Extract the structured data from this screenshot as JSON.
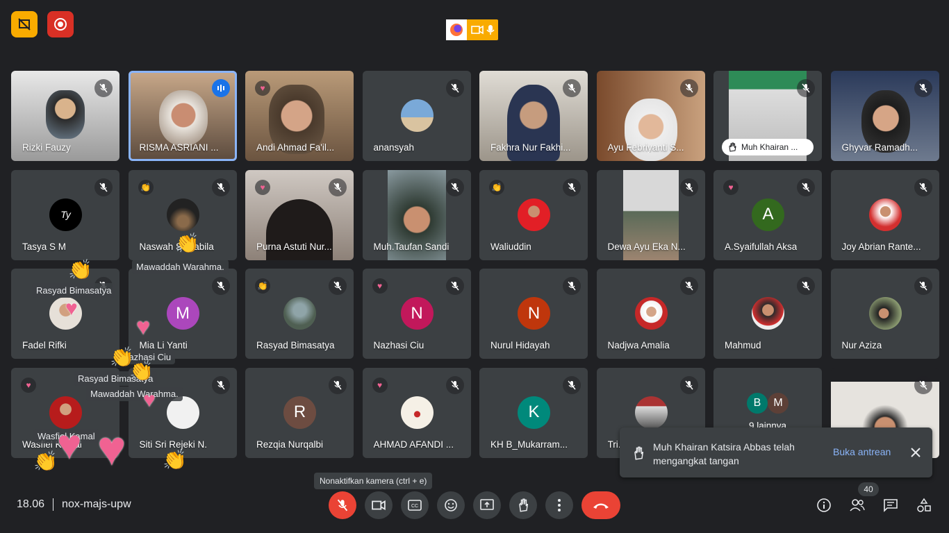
{
  "meeting": {
    "time": "18.06",
    "code": "nox-majs-upw",
    "participant_count": "40",
    "tooltip": "Nonaktifkan kamera (ctrl + e)"
  },
  "participants": [
    {
      "name": "Rizki Fauzy"
    },
    {
      "name": "RISMA ASRIANI ..."
    },
    {
      "name": "Andi Ahmad Fa'il..."
    },
    {
      "name": "anansyah"
    },
    {
      "name": "Fakhra Nur Fakhi..."
    },
    {
      "name": "Ayu Febriyanti S..."
    },
    {
      "name": "Muh Khairan ..."
    },
    {
      "name": "Ghyvar Ramadh..."
    },
    {
      "name": "Tasya S M"
    },
    {
      "name": "Naswah Salzabila"
    },
    {
      "name": "Purna Astuti Nur..."
    },
    {
      "name": "Muh.Taufan Sandi"
    },
    {
      "name": "Waliuddin"
    },
    {
      "name": "Dewa Ayu Eka N..."
    },
    {
      "name": "A.Syaifullah Aksa",
      "initial": "A"
    },
    {
      "name": "Joy Abrian Rante..."
    },
    {
      "name": "Fadel Rifki"
    },
    {
      "name": "Mia Li Yanti",
      "initial": "M"
    },
    {
      "name": "Rasyad Bimasatya"
    },
    {
      "name": "Nazhasi Ciu",
      "initial": "N"
    },
    {
      "name": "Nurul Hidayah",
      "initial": "N"
    },
    {
      "name": "Nadjwa Amalia"
    },
    {
      "name": "Mahmud"
    },
    {
      "name": "Nur Aziza"
    },
    {
      "name": "Wasfiel Kamal"
    },
    {
      "name": "Siti Sri Rejeki N."
    },
    {
      "name": "Rezqia Nurqalbi",
      "initial": "R"
    },
    {
      "name": "AHMAD AFANDI ..."
    },
    {
      "name": "KH B_Mukarram...",
      "initial": "K"
    },
    {
      "name": "Tri..."
    },
    {
      "name": "9 lainnya",
      "initials": [
        "B",
        "M"
      ]
    },
    {
      "name": ""
    }
  ],
  "reaction_labels": [
    "Rasyad Bimasatya",
    "Mawaddah Warahma.",
    "Nazhasi Ciu",
    "Rasyad Bimasatya",
    "Mawaddah Warahma.",
    "Wasfiel Kamal"
  ],
  "toast": {
    "message": "Muh Khairan Katsira Abbas telah mengangkat tangan",
    "action": "Buka antrean"
  },
  "colors": {
    "background": "#202124",
    "tile": "#3c4043",
    "accent": "#8ab4f8",
    "danger": "#ea4335",
    "record": "#d93025",
    "warn": "#f9ab00"
  },
  "icons": [
    "presenting-icon",
    "record-icon",
    "firefox-icon",
    "camera-icon",
    "mic-icon",
    "mic-off-icon",
    "hand-icon",
    "clap-icon",
    "heart-icon",
    "close-icon",
    "captions-icon",
    "emoji-icon",
    "present-icon",
    "more-icon",
    "end-call-icon",
    "info-icon",
    "people-icon",
    "chat-icon",
    "activities-icon"
  ]
}
